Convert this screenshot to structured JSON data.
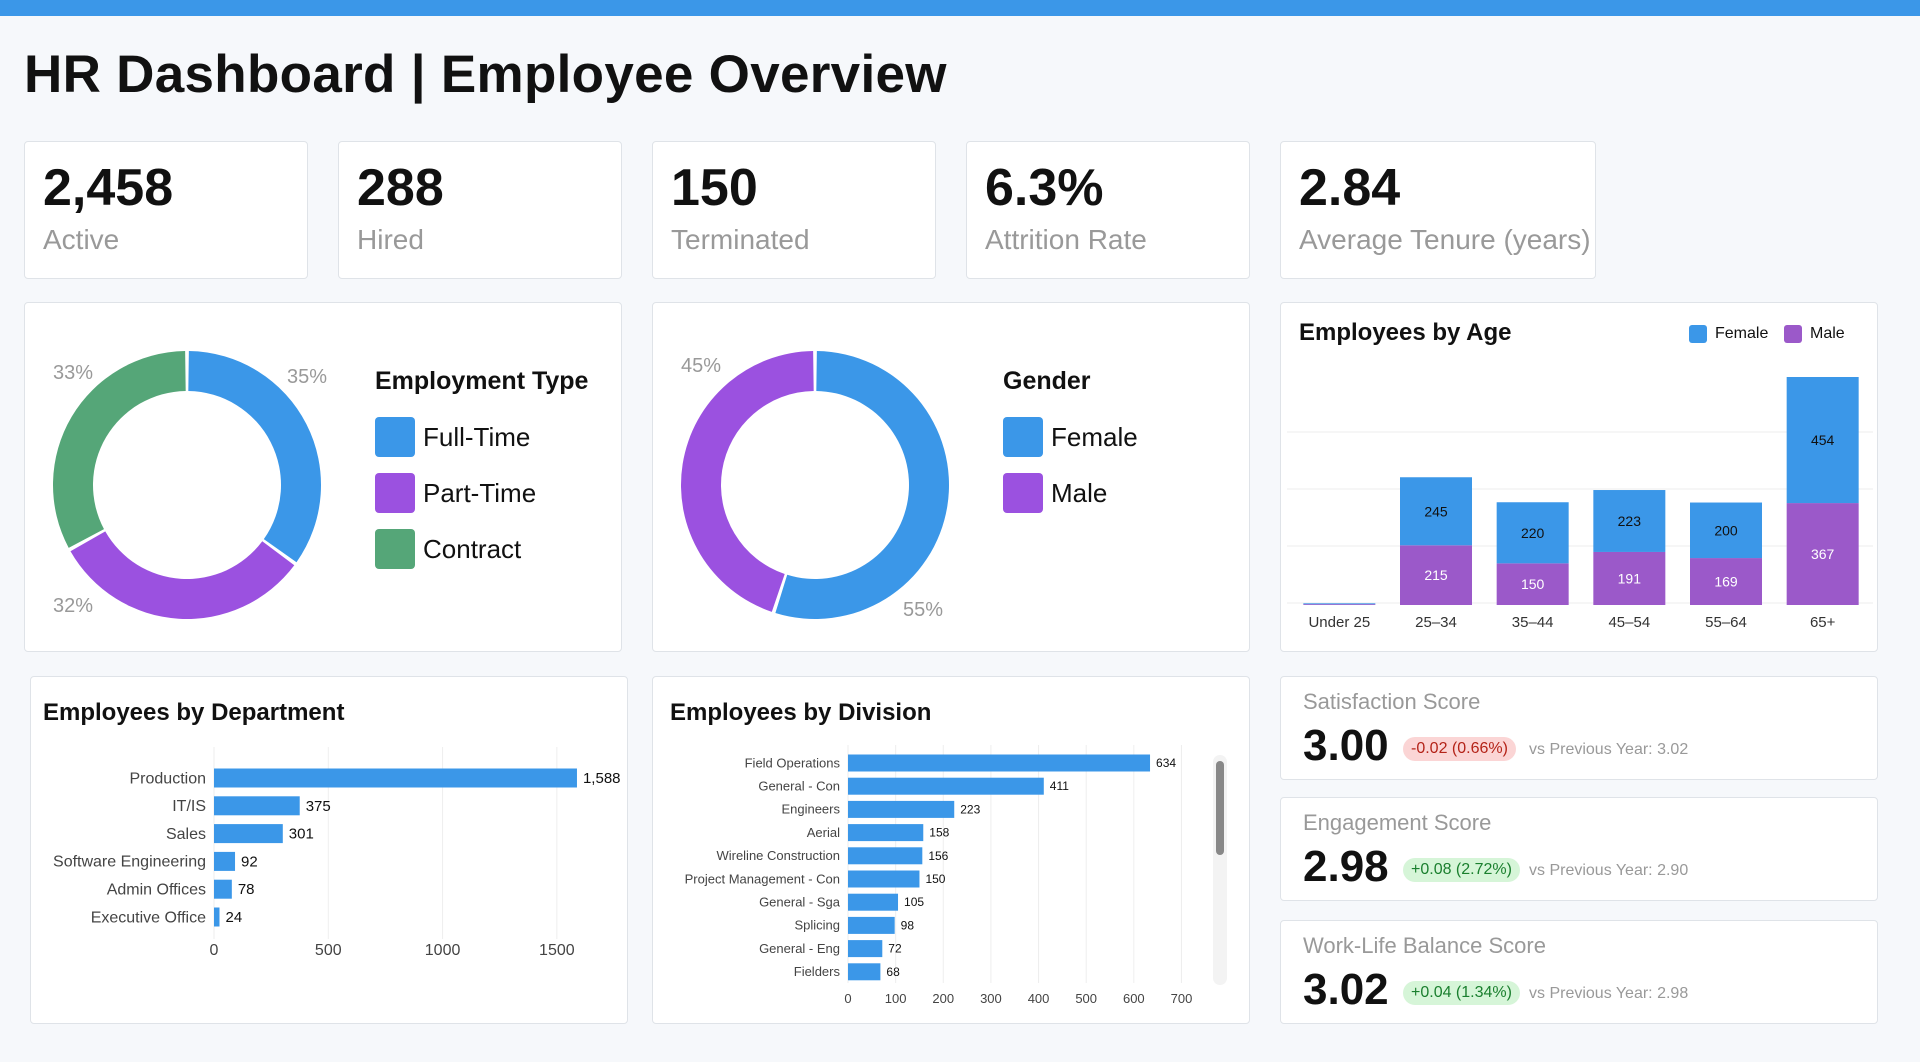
{
  "page": {
    "title": "HR Dashboard | Employee Overview"
  },
  "colors": {
    "blue": "#3b97e8",
    "purple": "#9b51e0",
    "green": "#55a678",
    "female": "#3b97e8",
    "male_bar": "#9b59c9",
    "male_donut": "#9b51e0"
  },
  "kpis": [
    {
      "value": "2,458",
      "label": "Active"
    },
    {
      "value": "288",
      "label": "Hired"
    },
    {
      "value": "150",
      "label": "Terminated"
    },
    {
      "value": "6.3%",
      "label": "Attrition Rate"
    },
    {
      "value": "2.84",
      "label": "Average Tenure (years)"
    }
  ],
  "employment_type": {
    "title": "Employment Type",
    "legend": [
      "Full-Time",
      "Part-Time",
      "Contract"
    ],
    "percent_labels": [
      "35%",
      "32%",
      "33%"
    ]
  },
  "gender": {
    "title": "Gender",
    "legend": [
      "Female",
      "Male"
    ],
    "percent_labels": [
      "55%",
      "45%"
    ]
  },
  "age": {
    "title": "Employees by Age",
    "legend": [
      "Female",
      "Male"
    ]
  },
  "department": {
    "title": "Employees by Department"
  },
  "division": {
    "title": "Employees by Division"
  },
  "scores": [
    {
      "label": "Satisfaction Score",
      "value": "3.00",
      "change": "-0.02 (0.66%)",
      "direction": "neg",
      "previous": "vs Previous Year: 3.02"
    },
    {
      "label": "Engagement Score",
      "value": "2.98",
      "change": "+0.08 (2.72%)",
      "direction": "pos",
      "previous": "vs Previous Year: 2.90"
    },
    {
      "label": "Work-Life Balance Score",
      "value": "3.02",
      "change": "+0.04 (1.34%)",
      "direction": "pos",
      "previous": "vs Previous Year: 2.98"
    }
  ],
  "chart_data": [
    {
      "type": "pie",
      "title": "Employment Type",
      "categories": [
        "Full-Time",
        "Part-Time",
        "Contract"
      ],
      "values": [
        35,
        32,
        33
      ],
      "colors": [
        "#3b97e8",
        "#9b51e0",
        "#55a678"
      ],
      "legend": "right"
    },
    {
      "type": "pie",
      "title": "Gender",
      "categories": [
        "Female",
        "Male"
      ],
      "values": [
        55,
        45
      ],
      "colors": [
        "#3b97e8",
        "#9b51e0"
      ],
      "legend": "right"
    },
    {
      "type": "bar",
      "title": "Employees by Age",
      "stacked": true,
      "categories": [
        "Under 25",
        "25–34",
        "35–44",
        "45–54",
        "55–64",
        "65+"
      ],
      "series": [
        {
          "name": "Male",
          "values": [
            3,
            215,
            150,
            191,
            169,
            367
          ]
        },
        {
          "name": "Female",
          "values": [
            3,
            245,
            220,
            223,
            200,
            454
          ]
        }
      ],
      "ylim": [
        0,
        821
      ],
      "legend": "top-right",
      "grid": true
    },
    {
      "type": "bar",
      "orientation": "horizontal",
      "title": "Employees by Department",
      "categories": [
        "Production",
        "IT/IS",
        "Sales",
        "Software Engineering",
        "Admin Offices",
        "Executive Office"
      ],
      "values": [
        1588,
        375,
        301,
        92,
        78,
        24
      ],
      "value_labels": [
        "1,588",
        "375",
        "301",
        "92",
        "78",
        "24"
      ],
      "xticks": [
        0,
        500,
        1000,
        1500
      ],
      "xlim": [
        0,
        1750
      ],
      "grid": true
    },
    {
      "type": "bar",
      "orientation": "horizontal",
      "title": "Employees by Division",
      "categories": [
        "Field Operations",
        "General - Con",
        "Engineers",
        "Aerial",
        "Wireline Construction",
        "Project Management - Con",
        "General - Sga",
        "Splicing",
        "General - Eng",
        "Fielders"
      ],
      "values": [
        634,
        411,
        223,
        158,
        156,
        150,
        105,
        98,
        72,
        68
      ],
      "xticks": [
        0,
        100,
        200,
        300,
        400,
        500,
        600,
        700
      ],
      "xlim": [
        0,
        720
      ],
      "grid": true
    }
  ]
}
